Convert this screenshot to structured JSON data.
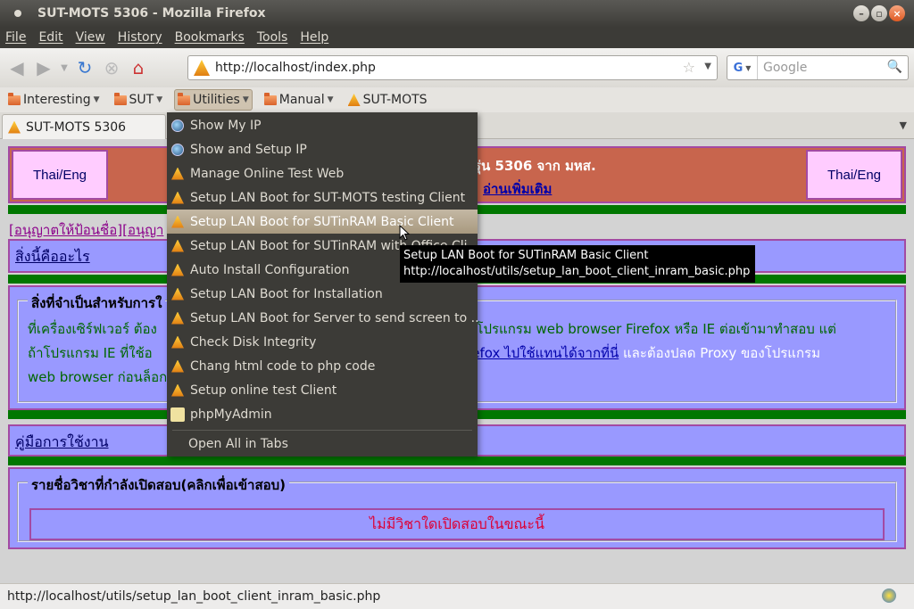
{
  "window": {
    "title": "SUT-MOTS 5306 - Mozilla Firefox"
  },
  "menubar": [
    "File",
    "Edit",
    "View",
    "History",
    "Bookmarks",
    "Tools",
    "Help"
  ],
  "navbar": {
    "url": "http://localhost/index.php",
    "search_placeholder": "Google"
  },
  "bookmarks": [
    {
      "label": "Interesting",
      "type": "folder"
    },
    {
      "label": "SUT",
      "type": "folder"
    },
    {
      "label": "Utilities",
      "type": "folder",
      "active": true
    },
    {
      "label": "Manual",
      "type": "folder"
    },
    {
      "label": "SUT-MOTS",
      "type": "page"
    }
  ],
  "tab": {
    "title": "SUT-MOTS 5306"
  },
  "page": {
    "thai_eng_left": "Thai/Eng",
    "thai_eng_right": "Thai/Eng",
    "banner_text": "รุ่น 5306 จาก มหส.",
    "banner_link": "อ่านเพิ่มเติม",
    "permit_link": "[อนุญาตให้ป้อนชื่อ][อนุญา",
    "what_link": "สิ่งนี้คืออะไร",
    "requirements_legend": "สิ่งที่จำเป็นสำหรับการใ",
    "req_line1_a": "ที่เครื่องเซิร์ฟเวอร์ ต้อง",
    "req_line1_b": "ใช้โปรแกรม web browser Firefox หรือ IE ต่อเข้ามาทำสอบ แต่",
    "req_line2_a": "ถ้าโปรแกรม IE ที่ใช้อ",
    "req_line2_link": "Firefox ไปใช้แทนได้จากที่นี่",
    "req_line2_b": "และต้องปลด Proxy ของโปรแกรม",
    "req_line3": "web browser ก่อนล็อก",
    "manual_link": "คู่มือการใช้งาน",
    "subjects_legend": "รายชื่อวิชาที่กำลังเปิดสอบ(คลิกเพื่อเข้าสอบ)",
    "no_exam": "ไม่มีวิชาใดเปิดสอบในขณะนี้"
  },
  "utilities_menu": [
    {
      "label": "Show My IP",
      "icon": "globe-icon"
    },
    {
      "label": "Show and Setup IP",
      "icon": "globe-icon"
    },
    {
      "label": "Manage Online Test Web",
      "icon": "cone-icon"
    },
    {
      "label": "Setup LAN Boot for SUT-MOTS testing Client",
      "icon": "cone-icon"
    },
    {
      "label": "Setup LAN Boot for SUTinRAM Basic Client",
      "icon": "cone-icon",
      "highlighted": true
    },
    {
      "label": "Setup LAN Boot for SUTinRAM with Office Cli...",
      "icon": "cone-icon"
    },
    {
      "label": "Auto Install Configuration",
      "icon": "cone-icon"
    },
    {
      "label": "Setup LAN Boot for Installation",
      "icon": "cone-icon"
    },
    {
      "label": "Setup LAN Boot for Server to send screen to ...",
      "icon": "cone-icon"
    },
    {
      "label": "Check Disk Integrity",
      "icon": "cone-icon"
    },
    {
      "label": "Chang html code to php code",
      "icon": "cone-icon"
    },
    {
      "label": "Setup online test Client",
      "icon": "cone-icon"
    },
    {
      "label": "phpMyAdmin",
      "icon": "phpmyadmin-icon"
    }
  ],
  "open_all_label": "Open All in Tabs",
  "tooltip": {
    "line1": "Setup LAN Boot for SUTinRAM Basic Client",
    "line2": "http://localhost/utils/setup_lan_boot_client_inram_basic.php"
  },
  "status": "http://localhost/utils/setup_lan_boot_client_inram_basic.php"
}
